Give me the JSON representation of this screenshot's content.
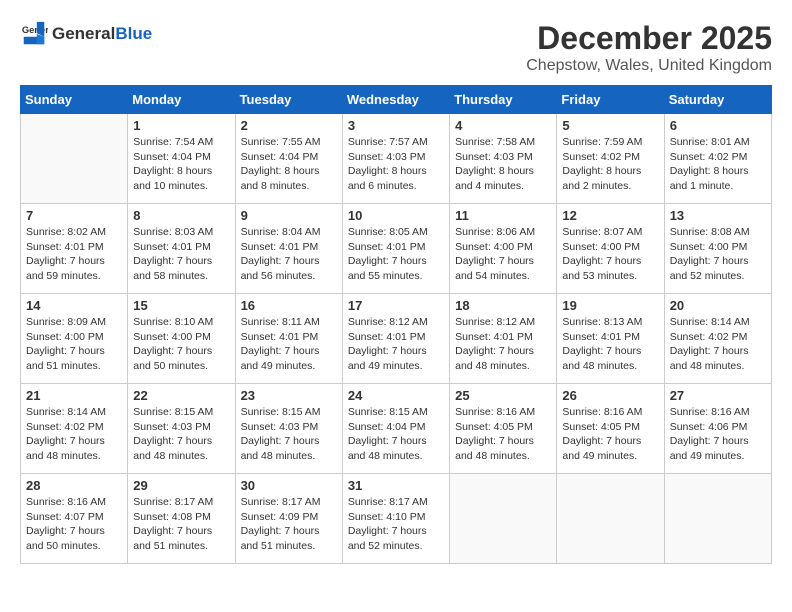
{
  "header": {
    "logo_general": "General",
    "logo_blue": "Blue",
    "month_year": "December 2025",
    "location": "Chepstow, Wales, United Kingdom"
  },
  "weekdays": [
    "Sunday",
    "Monday",
    "Tuesday",
    "Wednesday",
    "Thursday",
    "Friday",
    "Saturday"
  ],
  "weeks": [
    [
      {
        "day": "",
        "info": ""
      },
      {
        "day": "1",
        "info": "Sunrise: 7:54 AM\nSunset: 4:04 PM\nDaylight: 8 hours\nand 10 minutes."
      },
      {
        "day": "2",
        "info": "Sunrise: 7:55 AM\nSunset: 4:04 PM\nDaylight: 8 hours\nand 8 minutes."
      },
      {
        "day": "3",
        "info": "Sunrise: 7:57 AM\nSunset: 4:03 PM\nDaylight: 8 hours\nand 6 minutes."
      },
      {
        "day": "4",
        "info": "Sunrise: 7:58 AM\nSunset: 4:03 PM\nDaylight: 8 hours\nand 4 minutes."
      },
      {
        "day": "5",
        "info": "Sunrise: 7:59 AM\nSunset: 4:02 PM\nDaylight: 8 hours\nand 2 minutes."
      },
      {
        "day": "6",
        "info": "Sunrise: 8:01 AM\nSunset: 4:02 PM\nDaylight: 8 hours\nand 1 minute."
      }
    ],
    [
      {
        "day": "7",
        "info": "Sunrise: 8:02 AM\nSunset: 4:01 PM\nDaylight: 7 hours\nand 59 minutes."
      },
      {
        "day": "8",
        "info": "Sunrise: 8:03 AM\nSunset: 4:01 PM\nDaylight: 7 hours\nand 58 minutes."
      },
      {
        "day": "9",
        "info": "Sunrise: 8:04 AM\nSunset: 4:01 PM\nDaylight: 7 hours\nand 56 minutes."
      },
      {
        "day": "10",
        "info": "Sunrise: 8:05 AM\nSunset: 4:01 PM\nDaylight: 7 hours\nand 55 minutes."
      },
      {
        "day": "11",
        "info": "Sunrise: 8:06 AM\nSunset: 4:00 PM\nDaylight: 7 hours\nand 54 minutes."
      },
      {
        "day": "12",
        "info": "Sunrise: 8:07 AM\nSunset: 4:00 PM\nDaylight: 7 hours\nand 53 minutes."
      },
      {
        "day": "13",
        "info": "Sunrise: 8:08 AM\nSunset: 4:00 PM\nDaylight: 7 hours\nand 52 minutes."
      }
    ],
    [
      {
        "day": "14",
        "info": "Sunrise: 8:09 AM\nSunset: 4:00 PM\nDaylight: 7 hours\nand 51 minutes."
      },
      {
        "day": "15",
        "info": "Sunrise: 8:10 AM\nSunset: 4:00 PM\nDaylight: 7 hours\nand 50 minutes."
      },
      {
        "day": "16",
        "info": "Sunrise: 8:11 AM\nSunset: 4:01 PM\nDaylight: 7 hours\nand 49 minutes."
      },
      {
        "day": "17",
        "info": "Sunrise: 8:12 AM\nSunset: 4:01 PM\nDaylight: 7 hours\nand 49 minutes."
      },
      {
        "day": "18",
        "info": "Sunrise: 8:12 AM\nSunset: 4:01 PM\nDaylight: 7 hours\nand 48 minutes."
      },
      {
        "day": "19",
        "info": "Sunrise: 8:13 AM\nSunset: 4:01 PM\nDaylight: 7 hours\nand 48 minutes."
      },
      {
        "day": "20",
        "info": "Sunrise: 8:14 AM\nSunset: 4:02 PM\nDaylight: 7 hours\nand 48 minutes."
      }
    ],
    [
      {
        "day": "21",
        "info": "Sunrise: 8:14 AM\nSunset: 4:02 PM\nDaylight: 7 hours\nand 48 minutes."
      },
      {
        "day": "22",
        "info": "Sunrise: 8:15 AM\nSunset: 4:03 PM\nDaylight: 7 hours\nand 48 minutes."
      },
      {
        "day": "23",
        "info": "Sunrise: 8:15 AM\nSunset: 4:03 PM\nDaylight: 7 hours\nand 48 minutes."
      },
      {
        "day": "24",
        "info": "Sunrise: 8:15 AM\nSunset: 4:04 PM\nDaylight: 7 hours\nand 48 minutes."
      },
      {
        "day": "25",
        "info": "Sunrise: 8:16 AM\nSunset: 4:05 PM\nDaylight: 7 hours\nand 48 minutes."
      },
      {
        "day": "26",
        "info": "Sunrise: 8:16 AM\nSunset: 4:05 PM\nDaylight: 7 hours\nand 49 minutes."
      },
      {
        "day": "27",
        "info": "Sunrise: 8:16 AM\nSunset: 4:06 PM\nDaylight: 7 hours\nand 49 minutes."
      }
    ],
    [
      {
        "day": "28",
        "info": "Sunrise: 8:16 AM\nSunset: 4:07 PM\nDaylight: 7 hours\nand 50 minutes."
      },
      {
        "day": "29",
        "info": "Sunrise: 8:17 AM\nSunset: 4:08 PM\nDaylight: 7 hours\nand 51 minutes."
      },
      {
        "day": "30",
        "info": "Sunrise: 8:17 AM\nSunset: 4:09 PM\nDaylight: 7 hours\nand 51 minutes."
      },
      {
        "day": "31",
        "info": "Sunrise: 8:17 AM\nSunset: 4:10 PM\nDaylight: 7 hours\nand 52 minutes."
      },
      {
        "day": "",
        "info": ""
      },
      {
        "day": "",
        "info": ""
      },
      {
        "day": "",
        "info": ""
      }
    ]
  ]
}
